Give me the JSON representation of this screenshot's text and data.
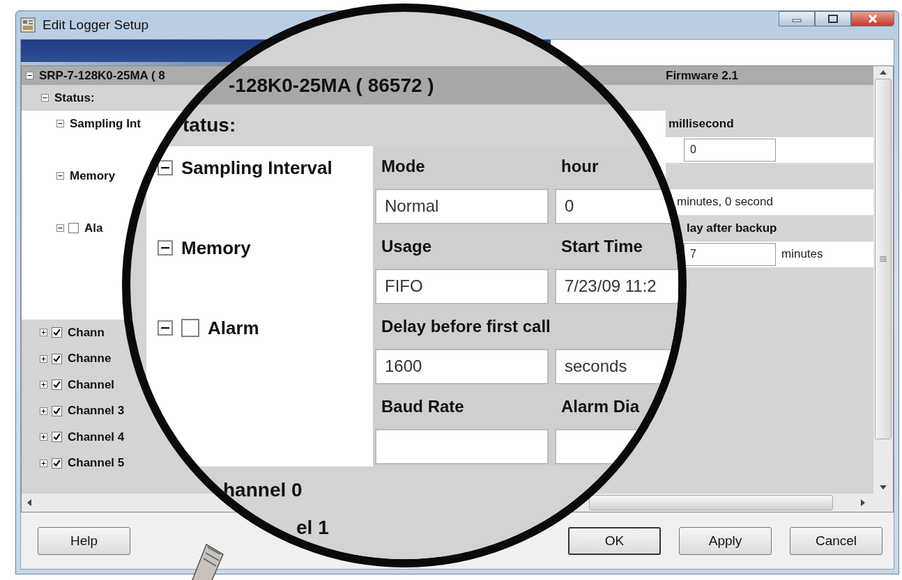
{
  "window": {
    "title": "Edit Logger Setup"
  },
  "tree": {
    "device": {
      "label": "SRP-7-128K0-25MA ( 8",
      "expanded": true
    },
    "firmware": "Firmware 2.1",
    "status": {
      "label": "Status:",
      "expanded": true
    },
    "items": [
      {
        "label": "Sampling Int",
        "kind": "group",
        "expanded": true
      },
      {
        "label": "Memory",
        "kind": "group",
        "expanded": true
      },
      {
        "label": "Ala",
        "kind": "check",
        "expanded": true,
        "checked": false
      }
    ],
    "channels": [
      {
        "label": "Chann",
        "expanded": false,
        "checked": true
      },
      {
        "label": "Channe",
        "expanded": false,
        "checked": true
      },
      {
        "label": "Channel",
        "expanded": false,
        "checked": true
      },
      {
        "label": "Channel 3",
        "expanded": false,
        "checked": true
      },
      {
        "label": "Channel 4",
        "expanded": false,
        "checked": true
      },
      {
        "label": "Channel 5",
        "expanded": false,
        "checked": true
      }
    ]
  },
  "settings": [
    {
      "label": "millisecond",
      "value": "0",
      "kind": "input"
    },
    {
      "value": "minutes, 0 second",
      "kind": "text"
    },
    {
      "label": "lay after backup",
      "value": "7",
      "unit": "minutes",
      "kind": "input"
    }
  ],
  "magnifier": {
    "title": "-128K0-25MA ( 86572 )",
    "section": "tatus:",
    "groups": [
      {
        "label": "Sampling Interval",
        "kind": "group",
        "expanded": true,
        "rows": [
          {
            "labels": [
              "Mode",
              "hour"
            ],
            "values": [
              "Normal",
              "0"
            ]
          }
        ]
      },
      {
        "label": "Memory",
        "kind": "group",
        "expanded": true,
        "rows": [
          {
            "labels": [
              "Usage",
              "Start Time"
            ],
            "values": [
              "FIFO",
              "7/23/09 11:2"
            ]
          }
        ]
      },
      {
        "label": "Alarm",
        "kind": "check",
        "expanded": true,
        "checked": false,
        "rows": [
          {
            "labels": [
              "Delay before first call"
            ],
            "values": [
              "1600",
              "seconds"
            ]
          },
          {
            "labels": [
              "Baud Rate",
              "Alarm Dia"
            ],
            "values": []
          }
        ]
      }
    ],
    "channels": [
      "hannel 0",
      "el 1"
    ]
  },
  "buttons": {
    "left": [
      "Help"
    ],
    "right": [
      "OK",
      "Apply",
      "Cancel"
    ]
  }
}
